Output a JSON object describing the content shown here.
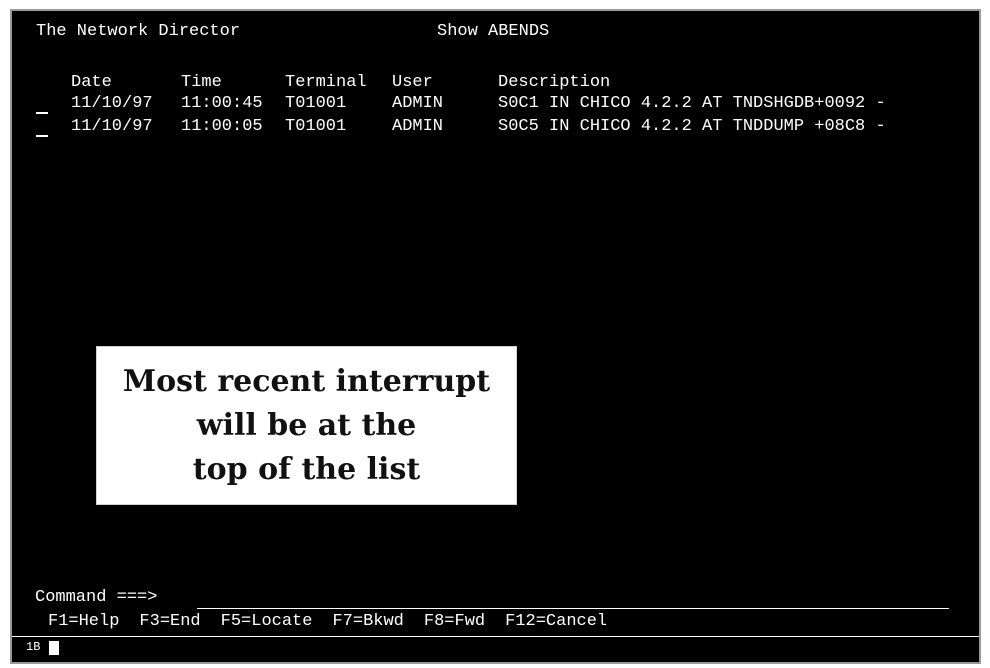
{
  "header": {
    "app_title": "The Network Director",
    "screen_title": "Show ABENDS"
  },
  "table": {
    "columns": [
      "Date",
      "Time",
      "Terminal",
      "User",
      "Description"
    ],
    "rows": [
      {
        "date": "11/10/97",
        "time": "11:00:45",
        "terminal": "T01001",
        "user": "ADMIN",
        "description": "S0C1 IN CHICO 4.2.2 AT TNDSHGDB+0092 -"
      },
      {
        "date": "11/10/97",
        "time": "11:00:05",
        "terminal": "T01001",
        "user": "ADMIN",
        "description": "S0C5 IN CHICO 4.2.2 AT TNDDUMP +08C8 -"
      }
    ]
  },
  "command": {
    "label": "Command ===>",
    "value": ""
  },
  "function_keys": [
    "F1=Help",
    "F3=End",
    "F5=Locate",
    "F7=Bkwd",
    "F8=Fwd",
    "F12=Cancel"
  ],
  "status": {
    "indicator": "1B"
  },
  "callout": {
    "lines": [
      "Most recent interrupt",
      "will be at the",
      "top of the list"
    ]
  }
}
